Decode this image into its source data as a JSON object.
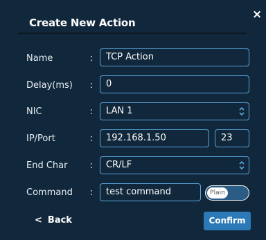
{
  "dialog": {
    "title": "Create New Action",
    "close_icon": "×"
  },
  "form": {
    "colon": ":",
    "name": {
      "label": "Name",
      "value": "TCP Action"
    },
    "delay": {
      "label": "Delay(ms)",
      "value": "0"
    },
    "nic": {
      "label": "NIC",
      "value": "LAN 1"
    },
    "ipport": {
      "label": "IP/Port",
      "ip": "192.168.1.50",
      "port": "23"
    },
    "endchar": {
      "label": "End Char",
      "value": "CR/LF"
    },
    "command": {
      "label": "Command",
      "value": "test command",
      "toggle_label": "Plain"
    }
  },
  "footer": {
    "back_label": "Back",
    "back_icon": "<",
    "confirm_label": "Confirm"
  },
  "colors": {
    "background": "#11273b",
    "field_border": "#5aa7dd",
    "confirm": "#2b79b7",
    "toggle": "#2b5c86"
  }
}
